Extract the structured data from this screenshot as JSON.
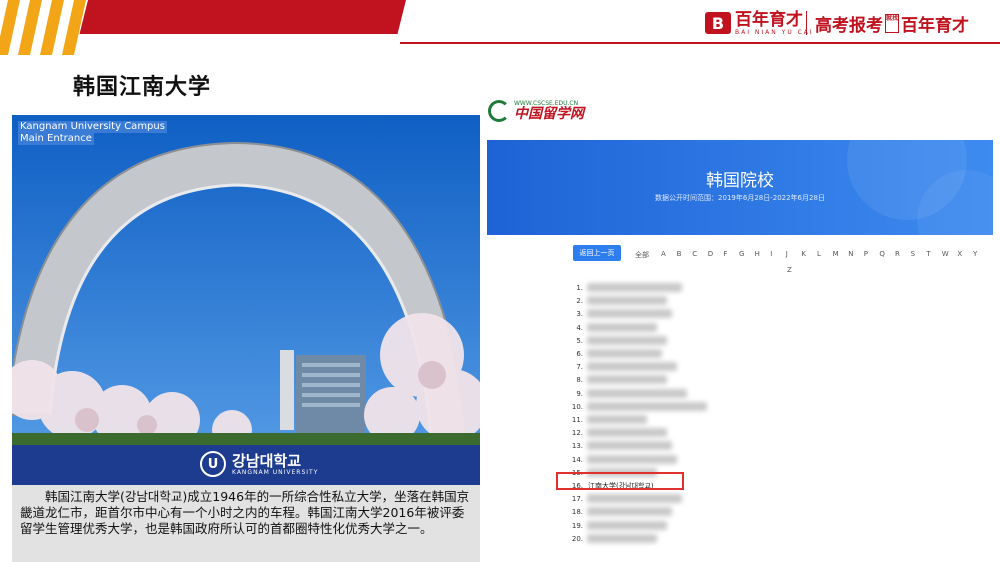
{
  "header": {
    "brand_mark": "B",
    "brand_name": "百年育才",
    "brand_pinyin": "BAI NIAN YU CAI",
    "slogan_left": "高考报考",
    "slogan_box": "就找",
    "slogan_right": "百年育才",
    "accent_color": "#c1121f"
  },
  "page_title": "韩国江南大学",
  "photo": {
    "caption_line1": "Kangnam University Campus",
    "caption_line2": "Main Entrance",
    "logo_mark": "U",
    "logo_name": "강남대학교",
    "logo_sub": "KANGNAM UNIVERSITY"
  },
  "description": "韩国江南大学(강남대학교)成立1946年的一所综合性私立大学，坐落在韩国京畿道龙仁市，距首尔市中心有一个小时之内的车程。韩国江南大学2016年被评委留学生管理优秀大学，也是韩国政府所认可的首都圈特性化优秀大学之一。",
  "screenshot": {
    "site_url": "WWW.CSCSE.EDU.CN",
    "site_name": "中国留学网",
    "banner_title": "韩国院校",
    "banner_sub": "数据公开时间范围：2019年6月28日-2022年6月28日",
    "back_button": "返回上一页",
    "filters": [
      "全部",
      "A",
      "B",
      "C",
      "D",
      "F",
      "G",
      "H",
      "I",
      "J",
      "K",
      "L",
      "M",
      "N",
      "P",
      "Q",
      "R",
      "S",
      "T",
      "W",
      "X",
      "Y",
      "Z"
    ],
    "rows": [
      {
        "num": "1.",
        "name": ""
      },
      {
        "num": "2.",
        "name": ""
      },
      {
        "num": "3.",
        "name": ""
      },
      {
        "num": "4.",
        "name": ""
      },
      {
        "num": "5.",
        "name": ""
      },
      {
        "num": "6.",
        "name": ""
      },
      {
        "num": "7.",
        "name": ""
      },
      {
        "num": "8.",
        "name": ""
      },
      {
        "num": "9.",
        "name": ""
      },
      {
        "num": "10.",
        "name": ""
      },
      {
        "num": "11.",
        "name": ""
      },
      {
        "num": "12.",
        "name": ""
      },
      {
        "num": "13.",
        "name": ""
      },
      {
        "num": "14.",
        "name": ""
      },
      {
        "num": "15.",
        "name": ""
      },
      {
        "num": "16.",
        "name": "江南大学(강남대학교)"
      },
      {
        "num": "17.",
        "name": ""
      },
      {
        "num": "18.",
        "name": ""
      },
      {
        "num": "19.",
        "name": ""
      },
      {
        "num": "20.",
        "name": ""
      }
    ],
    "highlight_color": "#e03030"
  }
}
